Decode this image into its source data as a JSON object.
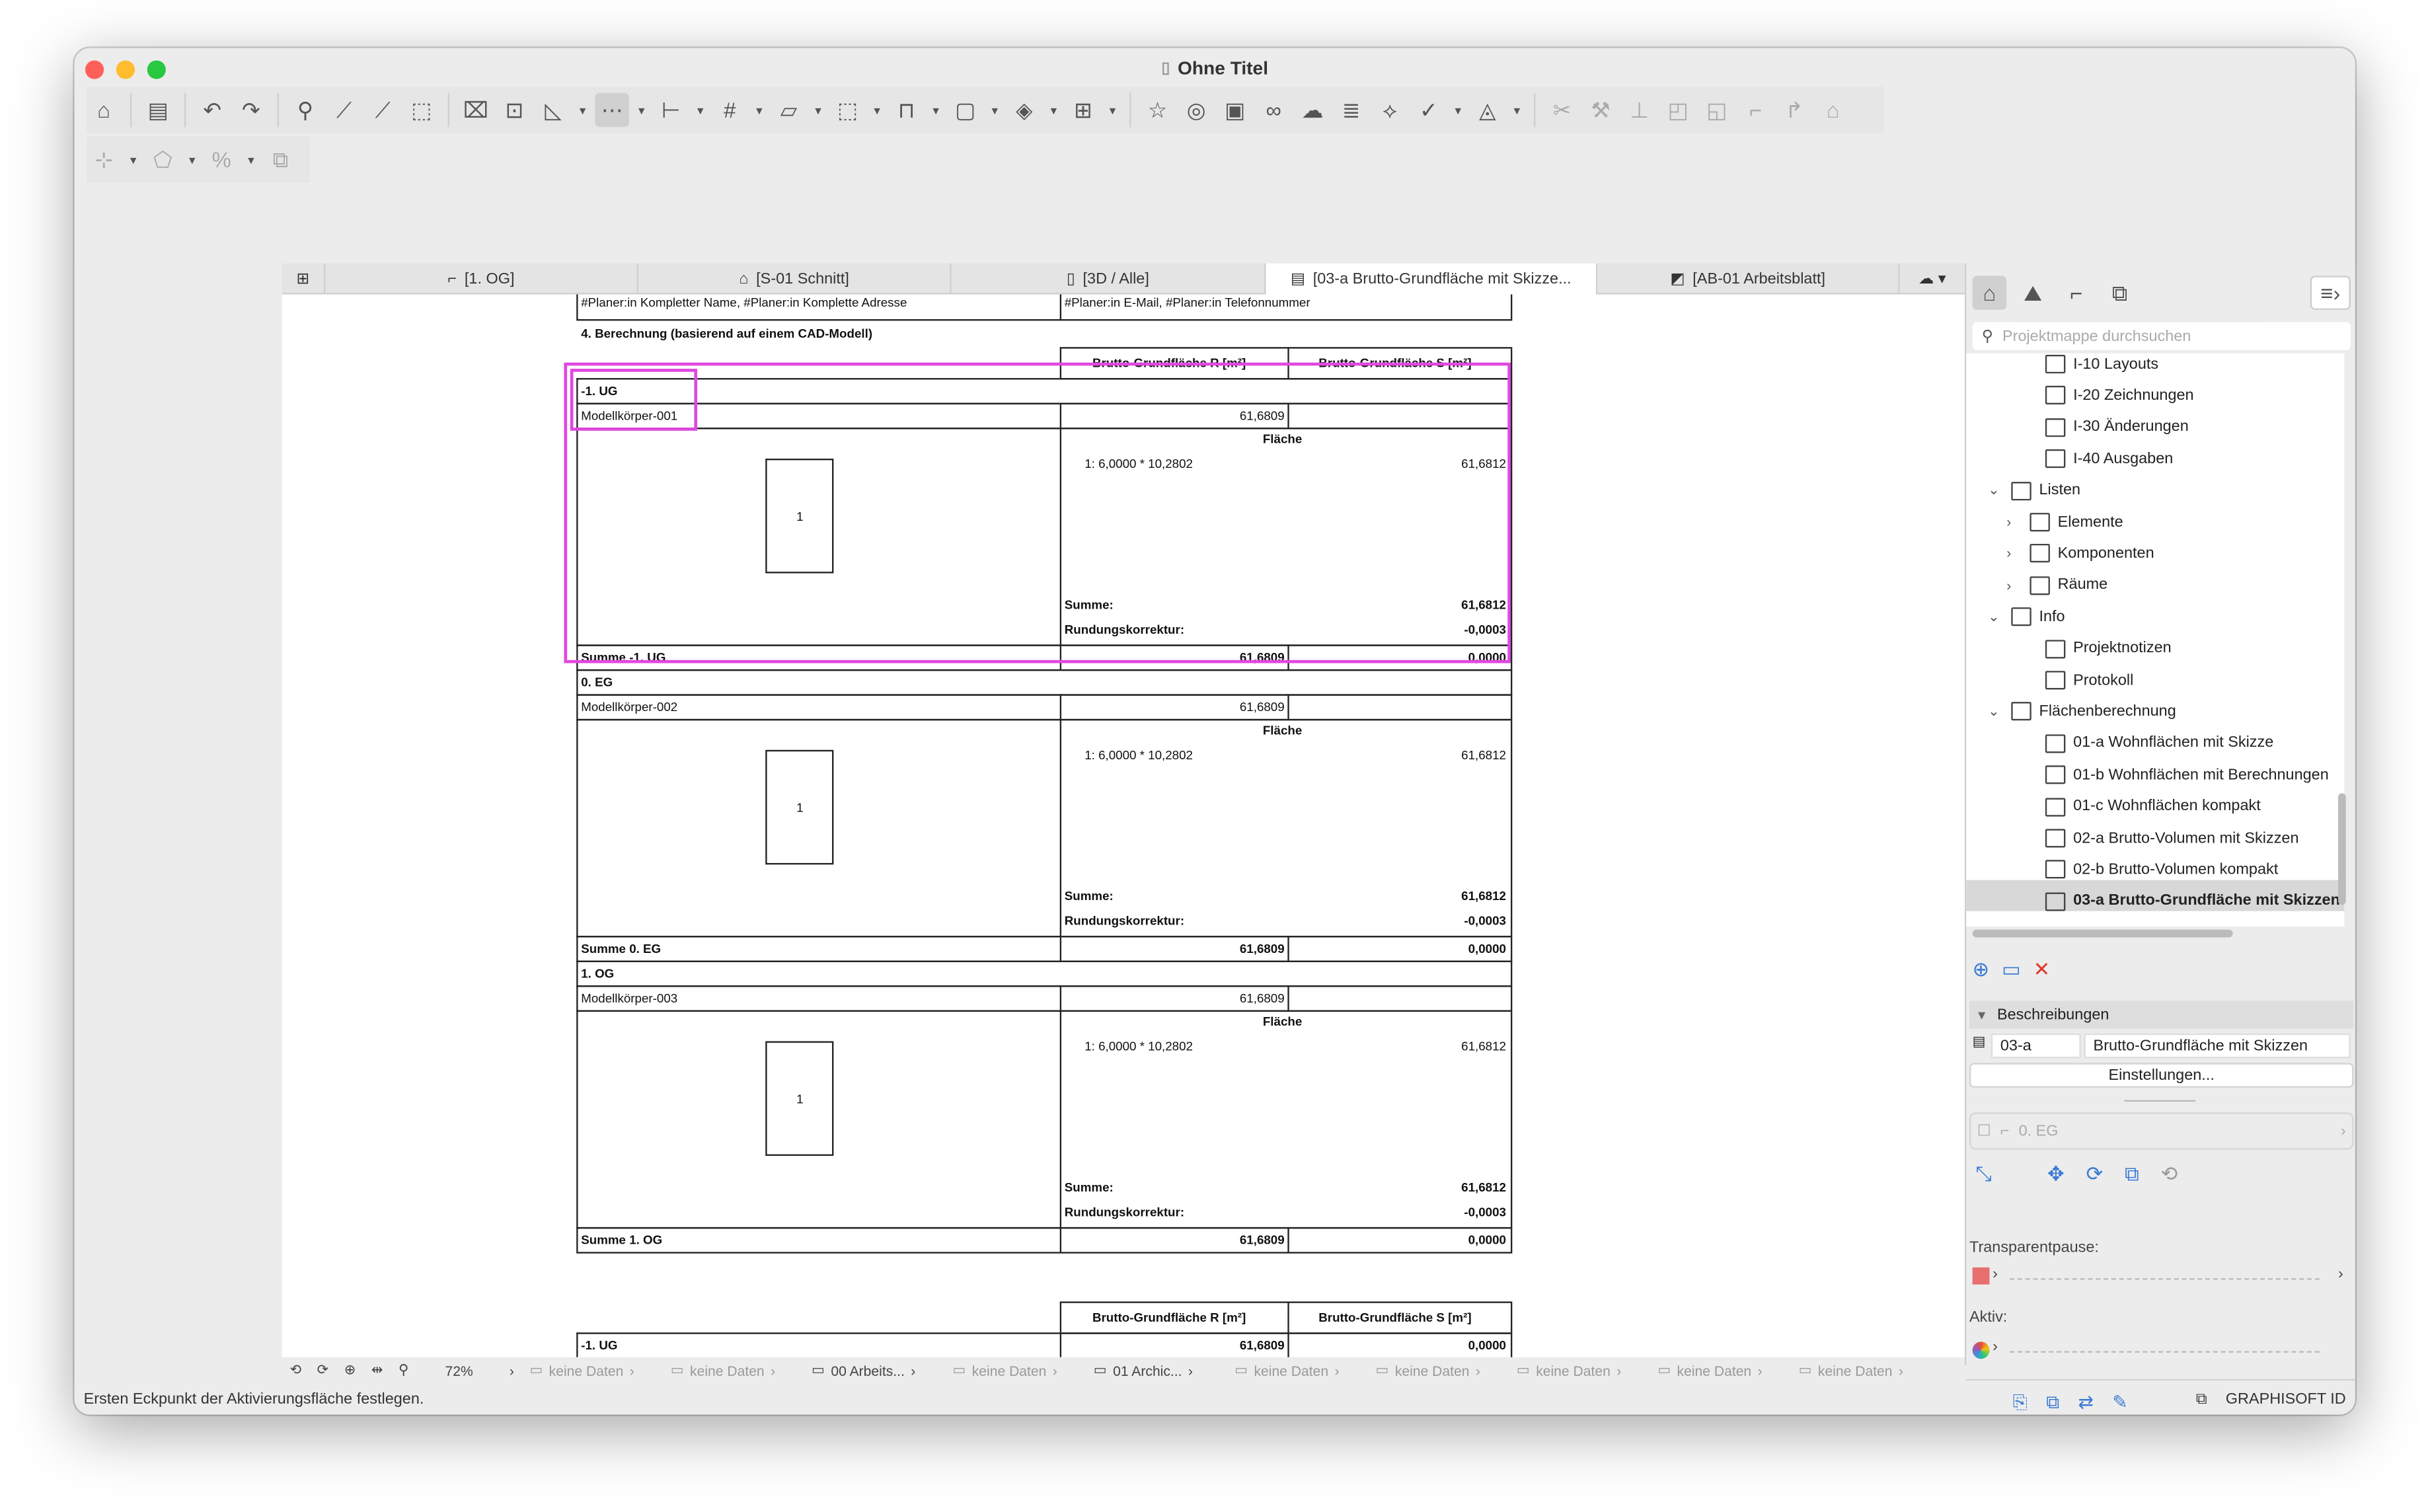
{
  "window": {
    "title": "Ohne Titel"
  },
  "tabs": [
    {
      "label": "[1. OG]",
      "icon": "floor-plan-icon"
    },
    {
      "label": "[S-01 Schnitt]",
      "icon": "section-icon"
    },
    {
      "label": "[3D / Alle]",
      "icon": "3d-icon"
    },
    {
      "label": "[03-a Brutto-Grundfläche mit Skizze...",
      "icon": "list-icon",
      "active": true
    },
    {
      "label": "[AB-01 Arbeitsblatt]",
      "icon": "worksheet-icon"
    }
  ],
  "doc": {
    "header_left": "#Planer:in Kompletter Name, #Planer:in Komplette Adresse",
    "header_right": "#Planer:in E-Mail, #Planer:in Telefonnummer",
    "section_title": "4. Berechnung (basierend auf einem CAD-Modell)",
    "col_r": "Brutto-Grundfläche R [m²]",
    "col_s": "Brutto-Grundfläche S [m²]",
    "flaeche": "Fläche",
    "formula_line": "1:  6,0000 * 10,2802",
    "formula_value": "61,6812",
    "summe_label": "Summe:",
    "summe_value": "61,6812",
    "rundung_label": "Rundungskorrektur:",
    "rundung_value": "-0,0003",
    "sketch_number": "1",
    "body_value": "61,6809",
    "zero": "0,0000",
    "blocks": [
      {
        "floor": "-1. UG",
        "body": "Modellkörper-001",
        "total_label": "Summe -1. UG"
      },
      {
        "floor": "0. EG",
        "body": "Modellkörper-002",
        "total_label": "Summe 0. EG"
      },
      {
        "floor": "1. OG",
        "body": "Modellkörper-003",
        "total_label": "Summe 1. OG"
      }
    ],
    "second_table": {
      "floor": "-1. UG",
      "r": "61,6809",
      "s": "0,0000"
    }
  },
  "status_bar": {
    "zoom": "72%",
    "items": [
      {
        "label": "keine Daten",
        "dim": true
      },
      {
        "label": "keine Daten",
        "dim": true
      },
      {
        "label": "00 Arbeits...",
        "dim": false
      },
      {
        "label": "keine Daten",
        "dim": true
      },
      {
        "label": "01 Archic...",
        "dim": false
      },
      {
        "label": "keine Daten",
        "dim": true
      },
      {
        "label": "keine Daten",
        "dim": true
      },
      {
        "label": "keine Daten",
        "dim": true
      },
      {
        "label": "keine Daten",
        "dim": true
      },
      {
        "label": "keine Daten",
        "dim": true
      }
    ]
  },
  "footer": {
    "message": "Ersten Eckpunkt der Aktivierungsfläche festlegen.",
    "brand": "GRAPHISOFT ID"
  },
  "navigator": {
    "search_placeholder": "Projektmappe durchsuchen",
    "items": [
      {
        "label": "I-10 Layouts",
        "level": 3,
        "chev": ""
      },
      {
        "label": "I-20 Zeichnungen",
        "level": 3,
        "chev": ""
      },
      {
        "label": "I-30 Änderungen",
        "level": 3,
        "chev": ""
      },
      {
        "label": "I-40 Ausgaben",
        "level": 3,
        "chev": ""
      },
      {
        "label": "Listen",
        "level": 1,
        "chev": "⌄"
      },
      {
        "label": "Elemente",
        "level": 2,
        "chev": "›"
      },
      {
        "label": "Komponenten",
        "level": 2,
        "chev": "›"
      },
      {
        "label": "Räume",
        "level": 2,
        "chev": "›"
      },
      {
        "label": "Info",
        "level": 1,
        "chev": "⌄"
      },
      {
        "label": "Projektnotizen",
        "level": 3,
        "chev": ""
      },
      {
        "label": "Protokoll",
        "level": 3,
        "chev": ""
      },
      {
        "label": "Flächenberechnung",
        "level": 1,
        "chev": "⌄"
      },
      {
        "label": "01-a Wohnflächen mit Skizze",
        "level": 3,
        "chev": ""
      },
      {
        "label": "01-b Wohnflächen mit Berechnungen",
        "level": 3,
        "chev": ""
      },
      {
        "label": "01-c Wohnflächen kompakt",
        "level": 3,
        "chev": ""
      },
      {
        "label": "02-a Brutto-Volumen mit Skizzen",
        "level": 3,
        "chev": ""
      },
      {
        "label": "02-b Brutto-Volumen kompakt",
        "level": 3,
        "chev": ""
      },
      {
        "label": "03-a Brutto-Grundfläche mit Skizzen",
        "level": 3,
        "chev": "",
        "selected": true
      }
    ],
    "descriptions_title": "Beschreibungen",
    "desc_id": "03-a",
    "desc_name": "Brutto-Grundfläche mit Skizzen",
    "settings_button": "Einstellungen...",
    "layer_placeholder": "0. EG",
    "transparent_label": "Transparentpause:",
    "active_label": "Aktiv:"
  }
}
